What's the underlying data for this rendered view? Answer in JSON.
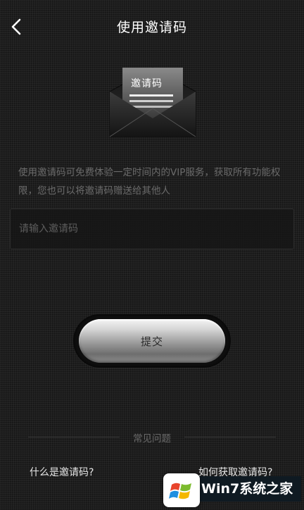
{
  "header": {
    "title": "使用邀请码",
    "back_icon": "chevron-left-icon"
  },
  "illustration": {
    "icon": "envelope-icon",
    "label": "邀请码"
  },
  "description": "使用邀请码可免费体验一定时间内的VIP服务，获取所有功能权限，您也可以将邀请码赠送给其他人",
  "invite_input": {
    "value": "",
    "placeholder": "请输入邀请码"
  },
  "submit": {
    "label": "提交"
  },
  "faq": {
    "title": "常见问题",
    "items": [
      "什么是邀请码?",
      "如何获取邀请码?"
    ]
  },
  "watermark": {
    "text": "Win7系统之家",
    "icon": "windows-logo-icon"
  },
  "colors": {
    "background": "#1f1f1f",
    "text_primary": "#ffffff",
    "text_muted": "#6b6b6b",
    "button_silver": "#c8c8c8"
  }
}
